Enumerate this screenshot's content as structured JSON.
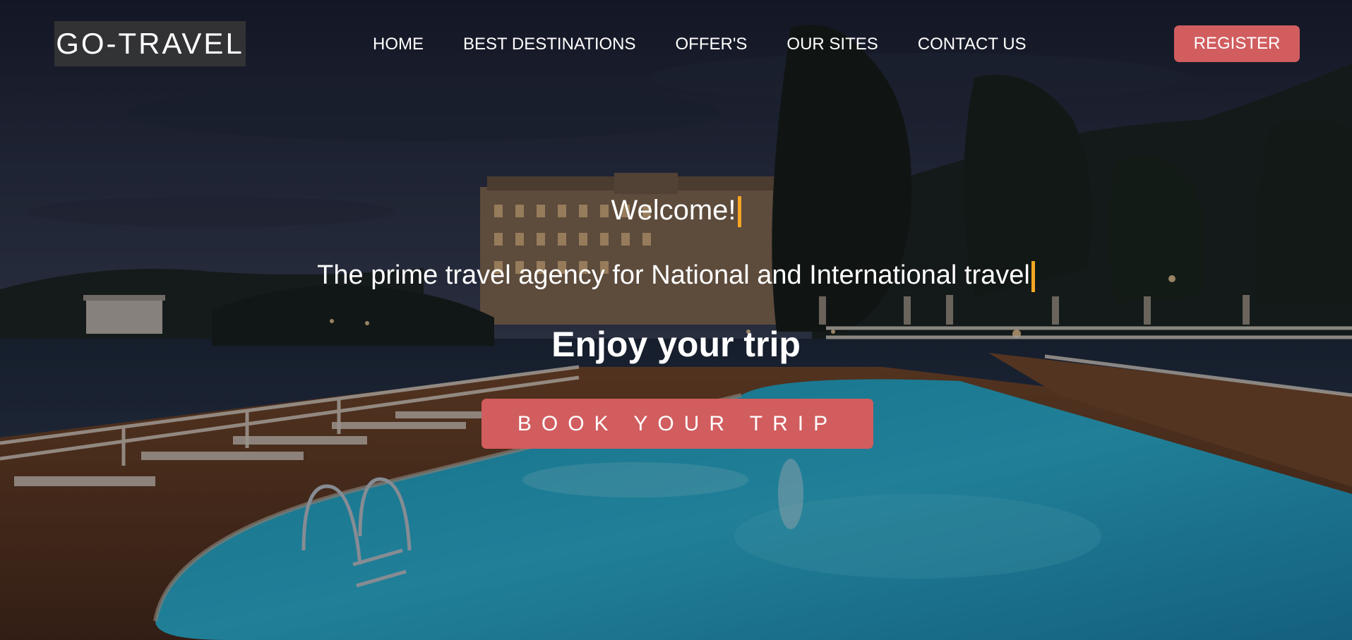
{
  "brand": {
    "logo_text": "GO-TRAVEL"
  },
  "nav": {
    "items": [
      {
        "label": "HOME"
      },
      {
        "label": "BEST DESTINATIONS"
      },
      {
        "label": "OFFER'S"
      },
      {
        "label": "OUR SITES"
      },
      {
        "label": "CONTACT US"
      }
    ],
    "register_label": "REGISTER"
  },
  "hero": {
    "welcome": "Welcome!",
    "tagline": "The prime travel agency for National and International travel",
    "headline": "Enjoy your trip",
    "cta_label": "BOOK YOUR TRIP",
    "background_image": "night resort pool by the lake"
  },
  "colors": {
    "accent": "#d15d5f",
    "caret": "#f5a623",
    "logo_bg": "#373737",
    "text": "#ffffff"
  }
}
